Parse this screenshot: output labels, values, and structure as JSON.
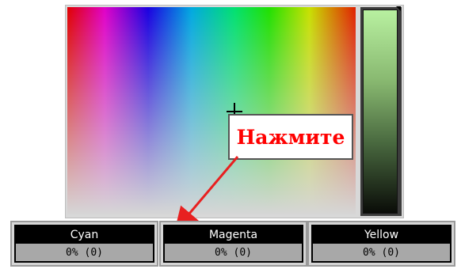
{
  "callout": {
    "text": "Нажмите"
  },
  "channels": [
    {
      "name": "Cyan",
      "value": "0% (0)"
    },
    {
      "name": "Magenta",
      "value": "0% (0)"
    },
    {
      "name": "Yellow",
      "value": "0% (0)"
    }
  ],
  "colors": {
    "callout_text": "#ff0000",
    "arrow": "#e82020",
    "channel_header_bg": "#000000",
    "channel_value_bg": "#a8a8a8"
  },
  "icons": [
    "crosshair-cursor",
    "luminance-marker-icon",
    "arrow-pointer"
  ]
}
